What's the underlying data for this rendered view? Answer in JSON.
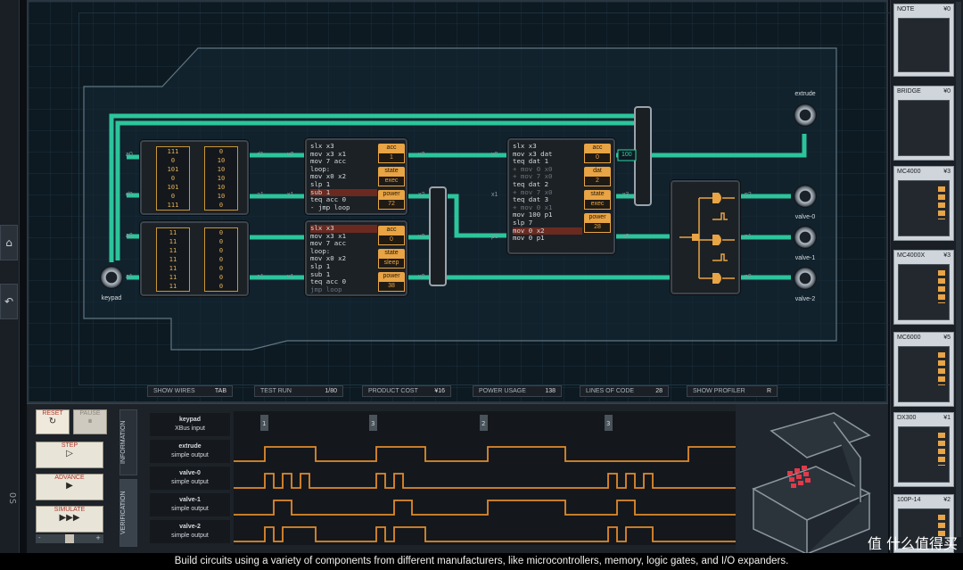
{
  "left_strip": {
    "home_icon": "home-icon",
    "undo_icon": "undo-icon",
    "logo": "OS"
  },
  "board": {
    "chips": [
      {
        "type": "memory",
        "cols": [
          [
            "111",
            "0",
            "101",
            "0",
            "101",
            "0",
            "111"
          ],
          [
            "0",
            "10",
            "10",
            "10",
            "10",
            "10",
            "0"
          ]
        ]
      },
      {
        "type": "memory",
        "cols": [
          [
            "11",
            "11",
            "11",
            "11",
            "11",
            "11",
            "11"
          ],
          [
            "0",
            "0",
            "0",
            "0",
            "0",
            "0",
            "0"
          ]
        ]
      }
    ],
    "mc1": {
      "code": [
        "slx x3",
        "mov x3 x1",
        "mov 7 acc",
        "loop:",
        "mov x0 x2",
        "slp 1",
        "sub 1",
        "teq acc 0",
        "- jmp loop"
      ],
      "hl_line": 6,
      "regs": [
        {
          "label": "acc",
          "value": "1"
        },
        {
          "label": "state",
          "value": "exec"
        },
        {
          "label": "power",
          "value": "72"
        }
      ]
    },
    "mc2": {
      "code": [
        "slx x3",
        "mov x3 x1",
        "mov 7 acc",
        "loop:",
        "mov x0 x2",
        "slp 1",
        "sub 1",
        "teq acc 0",
        "jmp loop"
      ],
      "hl_line": 0,
      "dim_lines": [
        8
      ],
      "regs": [
        {
          "label": "acc",
          "value": "0"
        },
        {
          "label": "state",
          "value": "sleep"
        },
        {
          "label": "power",
          "value": "38"
        }
      ]
    },
    "mc3": {
      "code": [
        "slx x3",
        "mov x3 dat",
        "teq dat 1",
        "+ mov 0 x0",
        "+ mov 7 x0",
        "teq dat 2",
        "+ mov 7 x0",
        "teq dat 3",
        "+ mov 0 x1",
        "mov 100 p1",
        "slp 7",
        "mov 0 x2",
        "mov 0 p1"
      ],
      "hl_line": 11,
      "dim_lines": [
        3,
        4,
        6,
        8
      ],
      "regs": [
        {
          "label": "acc",
          "value": "0"
        },
        {
          "label": "dat",
          "value": "2"
        },
        {
          "label": "state",
          "value": "exec"
        },
        {
          "label": "power",
          "value": "28"
        }
      ]
    },
    "pins": {
      "a0a": "a0",
      "d0": "d0",
      "a0b": "a0",
      "a1": "a1",
      "d1": "d1",
      "x0a": "x0",
      "a1b": "a1",
      "x1a": "x1",
      "a1c": "a1",
      "x1b": "x1",
      "x3a": "x3",
      "x2a": "x2",
      "x3b": "x3",
      "x2b": "x2",
      "x0b": "x0",
      "x1c": "x1",
      "p0": "p0",
      "x3c": "x3",
      "x2c": "x2",
      "p2": "p2",
      "p1": "p1",
      "p0b": "p0",
      "bus": "100"
    },
    "io": {
      "keypad": "keypad",
      "extrude": "extrude",
      "valve0": "valve-0",
      "valve1": "valve-1",
      "valve2": "valve-2"
    }
  },
  "statusbar": {
    "show_wires": "SHOW WIRES",
    "show_wires_key": "TAB",
    "test_run": "TEST RUN",
    "test_run_val": "1/80",
    "product_cost": "PRODUCT COST",
    "product_cost_val": "¥16",
    "power_usage": "POWER USAGE",
    "power_usage_val": "138",
    "lines_of_code": "LINES OF CODE",
    "lines_of_code_val": "28",
    "show_profiler": "SHOW PROFILER",
    "show_profiler_key": "R"
  },
  "parts": [
    {
      "name": "NOTE",
      "price": "¥0"
    },
    {
      "name": "BRIDGE",
      "price": "¥0"
    },
    {
      "name": "MC4000",
      "price": "¥3"
    },
    {
      "name": "MC4000X",
      "price": "¥3"
    },
    {
      "name": "MC6000",
      "price": "¥5"
    },
    {
      "name": "DX300",
      "price": "¥1"
    },
    {
      "name": "100P-14",
      "price": "¥2"
    }
  ],
  "controls": {
    "reset": "RESET",
    "pause": "PAUSE",
    "step": "STEP",
    "advance": "ADVANCE",
    "simulate": "SIMULATE",
    "speed_minus": "-",
    "speed_plus": "+"
  },
  "tabs": {
    "information": "INFORMATION",
    "verification": "VERIFICATION"
  },
  "signals": [
    {
      "name": "keypad",
      "type": "XBus input"
    },
    {
      "name": "extrude",
      "type": "simple output"
    },
    {
      "name": "valve-0",
      "type": "simple output"
    },
    {
      "name": "valve-1",
      "type": "simple output"
    },
    {
      "name": "valve-2",
      "type": "simple output"
    }
  ],
  "keypad_marks": [
    "1",
    "3",
    "2",
    "3"
  ],
  "caption": "Build circuits using a variety of components from different manufacturers, like microcontrollers, memory, logic gates, and I/O expanders.",
  "watermark": "值 什么值得买",
  "colors": {
    "wire": "#2fd7a8",
    "accent": "#e8a445",
    "board": "#0d1a22",
    "wave": "#e08a2c"
  }
}
